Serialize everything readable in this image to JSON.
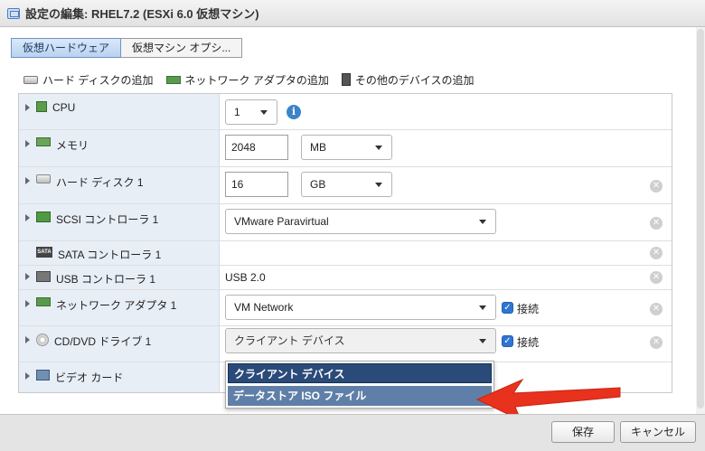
{
  "window": {
    "title": "設定の編集: RHEL7.2 (ESXi 6.0 仮想マシン)"
  },
  "tabs": [
    {
      "label": "仮想ハードウェア",
      "active": true
    },
    {
      "label": "仮想マシン オプシ...",
      "active": false
    }
  ],
  "toolbar": {
    "add_disk": "ハード ディスクの追加",
    "add_network": "ネットワーク アダプタの追加",
    "add_other": "その他のデバイスの追加"
  },
  "hardware": {
    "cpu": {
      "label": "CPU",
      "value": "1"
    },
    "memory": {
      "label": "メモリ",
      "value": "2048",
      "unit": "MB"
    },
    "disk": {
      "label": "ハード ディスク 1",
      "value": "16",
      "unit": "GB"
    },
    "scsi": {
      "label": "SCSI コントローラ 1",
      "value": "VMware Paravirtual"
    },
    "sata": {
      "label": "SATA コントローラ 1"
    },
    "usb": {
      "label": "USB コントローラ 1",
      "value": "USB 2.0"
    },
    "network": {
      "label": "ネットワーク アダプタ 1",
      "value": "VM Network",
      "connect_label": "接続",
      "connected": true
    },
    "cdrom": {
      "label": "CD/DVD ドライブ 1",
      "value": "クライアント デバイス",
      "connect_label": "接続",
      "connected": true
    },
    "video": {
      "label": "ビデオ カード"
    }
  },
  "dropdown": {
    "options": [
      "クライアント デバイス",
      "データストア ISO ファイル"
    ]
  },
  "footer": {
    "save": "保存",
    "cancel": "キャンセル"
  },
  "colors": {
    "accent": "#2f76d2",
    "selected_option": "#2a4a79",
    "highlight_option": "#5f7fa8",
    "arrow": "#e8321e"
  }
}
